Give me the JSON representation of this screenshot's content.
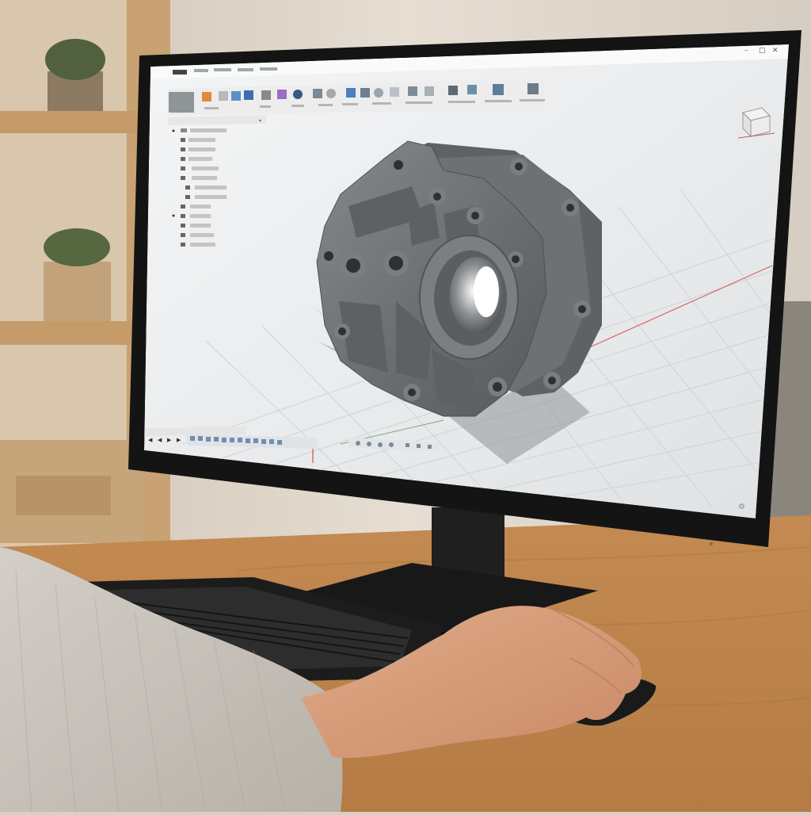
{
  "scene": {
    "caption": "",
    "subject": "person using 3D CAD software on a desktop monitor",
    "colors": {
      "wall": "#e2dbd1",
      "desk": "#c9955c",
      "shelf_wood": "#c8a273",
      "sweater": "#c9c4bd",
      "skin": "#d59a78",
      "monitor_frame": "#1a1a1a",
      "viewport_bg": "#e9ebed",
      "toolbar_bg": "#f1f1f1",
      "part_metal": "#6e7275"
    }
  },
  "cad_app": {
    "window_controls": [
      "minimize",
      "maximize",
      "close"
    ],
    "toolbar_groups": 8,
    "browser_tree_rows": 14,
    "view_cube_icon": "view-cube-icon",
    "settings_icon": "gear-icon",
    "timeline_controls": [
      "first",
      "previous",
      "play",
      "last"
    ]
  }
}
